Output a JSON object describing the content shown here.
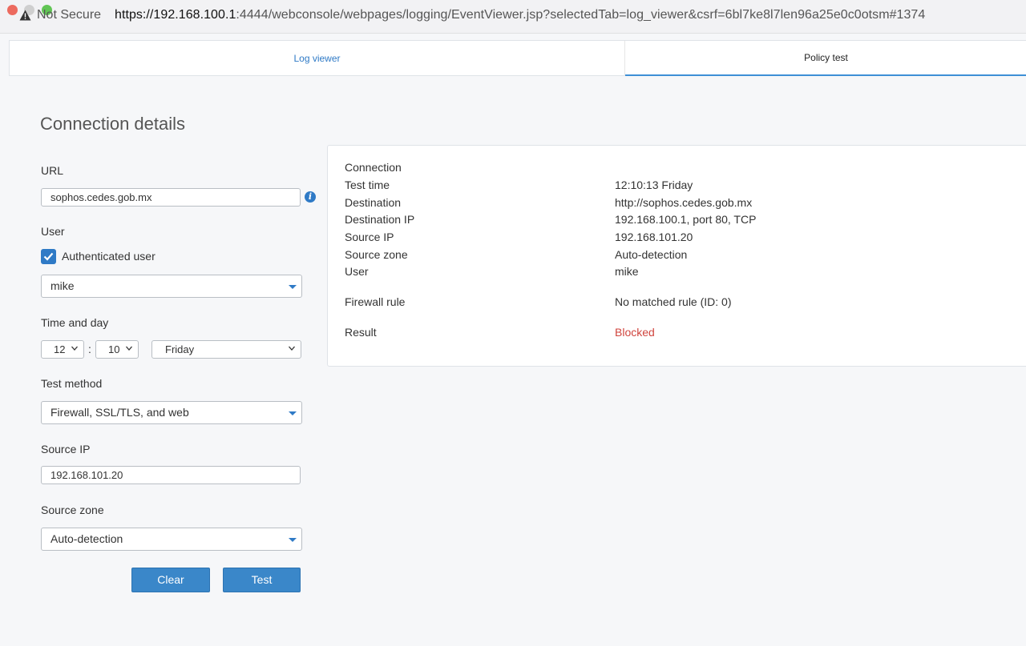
{
  "browser": {
    "security_label": "Not Secure",
    "url_host": "https://192.168.100.1",
    "url_rest": ":4444/webconsole/webpages/logging/EventViewer.jsp?selectedTab=log_viewer&csrf=6bl7ke8l7len96a25e0c0otsm#1374"
  },
  "tabs": [
    {
      "label": "Log viewer",
      "active": false
    },
    {
      "label": "Policy test",
      "active": true
    }
  ],
  "form": {
    "heading": "Connection details",
    "url_label": "URL",
    "url_value": "sophos.cedes.gob.mx",
    "user_label": "User",
    "auth_checkbox_label": "Authenticated user",
    "auth_checked": true,
    "user_value": "mike",
    "time_label": "Time and day",
    "hour": "12",
    "minute": "10",
    "day": "Friday",
    "method_label": "Test method",
    "method_value": "Firewall, SSL/TLS, and web",
    "source_ip_label": "Source IP",
    "source_ip_value": "192.168.101.20",
    "source_zone_label": "Source zone",
    "source_zone_value": "Auto-detection",
    "clear_label": "Clear",
    "test_label": "Test"
  },
  "result": {
    "connection_heading": "Connection",
    "rows": [
      {
        "key": "Test time",
        "value": "12:10:13 Friday"
      },
      {
        "key": "Destination",
        "value": "http://sophos.cedes.gob.mx"
      },
      {
        "key": "Destination IP",
        "value": "192.168.100.1, port 80, TCP"
      },
      {
        "key": "Source IP",
        "value": "192.168.101.20"
      },
      {
        "key": "Source zone",
        "value": "Auto-detection"
      },
      {
        "key": "User",
        "value": "mike"
      }
    ],
    "firewall_rule_label": "Firewall rule",
    "firewall_rule_value": "No matched rule (ID: 0)",
    "result_label": "Result",
    "result_value": "Blocked"
  },
  "colors": {
    "accent": "#2f7ac6",
    "blocked": "#d0453e"
  }
}
